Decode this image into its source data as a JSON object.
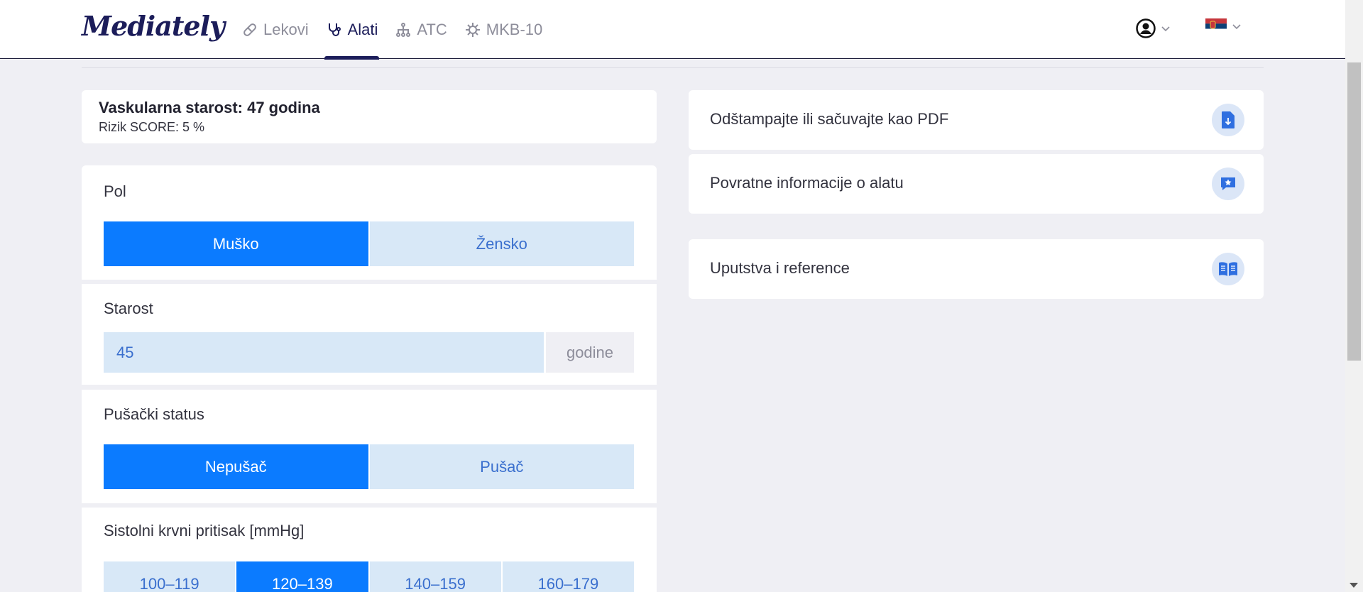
{
  "header": {
    "logo": "Mediately",
    "nav": [
      {
        "label": "Lekovi",
        "icon": "pill-icon"
      },
      {
        "label": "Alati",
        "icon": "stethoscope-icon",
        "active": true
      },
      {
        "label": "ATC",
        "icon": "hierarchy-icon"
      },
      {
        "label": "MKB-10",
        "icon": "virus-icon"
      }
    ],
    "user_icon": "user-circle-icon",
    "language_icon": "serbia-flag-icon"
  },
  "result": {
    "title": "Vaskularna starost: 47 godina",
    "subtitle": "Rizik SCORE: 5 %"
  },
  "form": {
    "sex": {
      "label": "Pol",
      "options": [
        "Muško",
        "Žensko"
      ],
      "selected": "Muško"
    },
    "age": {
      "label": "Starost",
      "value": "45",
      "unit": "godine"
    },
    "smoking": {
      "label": "Pušački status",
      "options": [
        "Nepušač",
        "Pušač"
      ],
      "selected": "Nepušač"
    },
    "systolic": {
      "label": "Sistolni krvni pritisak [mmHg]",
      "options": [
        "100–119",
        "120–139",
        "140–159",
        "160–179"
      ],
      "selected": "120–139"
    }
  },
  "actions": [
    {
      "label": "Odštampajte ili sačuvajte kao PDF",
      "icon": "pdf-download-icon"
    },
    {
      "label": "Povratne informacije o alatu",
      "icon": "feedback-star-icon"
    },
    {
      "label": "Uputstva i reference",
      "icon": "book-icon"
    }
  ],
  "colors": {
    "brand": "#1c1d5a",
    "accent": "#0b7bff",
    "segment_bg": "#d8e8f7",
    "segment_text": "#3a6fce",
    "page_bg": "#efeff4"
  }
}
